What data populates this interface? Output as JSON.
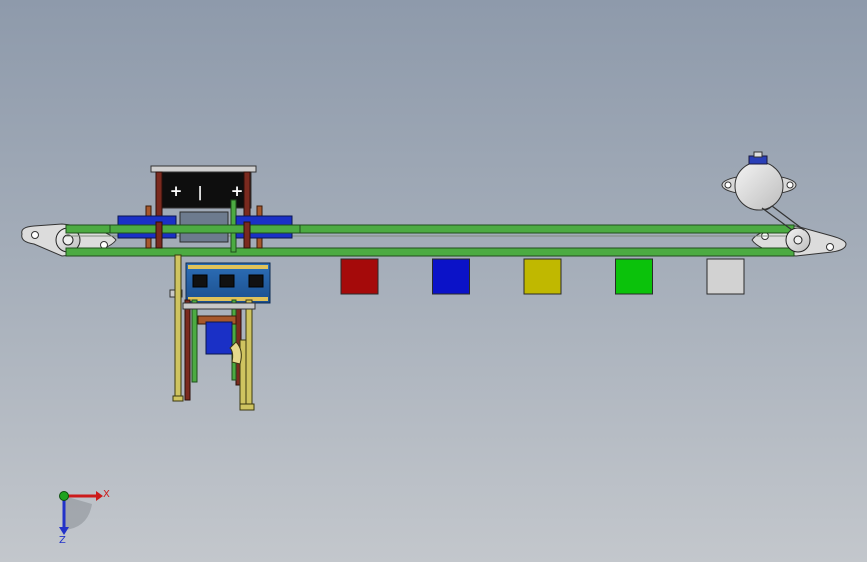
{
  "viewport": {
    "background_top": "#8e9aab",
    "background_bottom": "#c3c7cc"
  },
  "conveyor": {
    "belt_color": "#4cab42",
    "frame_color": "#cfcfcf"
  },
  "battery": {
    "terminal_left": "+",
    "terminal_middle": "|",
    "terminal_right": "+"
  },
  "color_blocks": [
    {
      "name": "red",
      "color": "#a50a0a"
    },
    {
      "name": "blue",
      "color": "#0b12c8"
    },
    {
      "name": "yellow",
      "color": "#c0b800"
    },
    {
      "name": "green",
      "color": "#0bc20b"
    },
    {
      "name": "white",
      "color": "#d2d2d2"
    }
  ],
  "triad": {
    "x_label": "X",
    "z_label": "Z",
    "x_color": "#cc1b1b",
    "y_color": "#1fa31f",
    "z_color": "#2232c9"
  }
}
